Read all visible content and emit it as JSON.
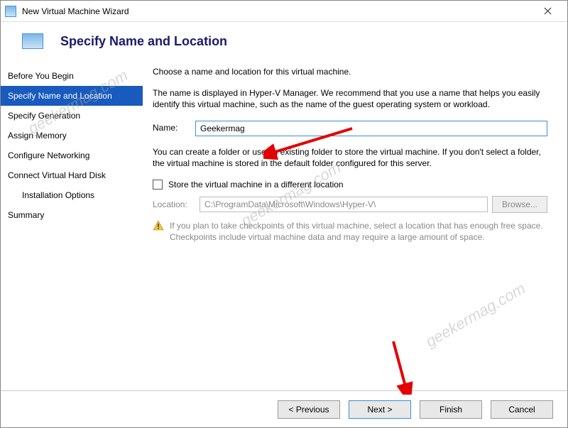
{
  "window": {
    "title": "New Virtual Machine Wizard"
  },
  "header": {
    "title": "Specify Name and Location"
  },
  "sidebar": {
    "items": [
      {
        "label": "Before You Begin"
      },
      {
        "label": "Specify Name and Location"
      },
      {
        "label": "Specify Generation"
      },
      {
        "label": "Assign Memory"
      },
      {
        "label": "Configure Networking"
      },
      {
        "label": "Connect Virtual Hard Disk"
      },
      {
        "label": "Installation Options"
      },
      {
        "label": "Summary"
      }
    ]
  },
  "content": {
    "intro": "Choose a name and location for this virtual machine.",
    "desc": "The name is displayed in Hyper-V Manager. We recommend that you use a name that helps you easily identify this virtual machine, such as the name of the guest operating system or workload.",
    "name_label": "Name:",
    "name_value": "Geekermag",
    "folder_desc": "You can create a folder or use an existing folder to store the virtual machine. If you don't select a folder, the virtual machine is stored in the default folder configured for this server.",
    "store_chk_label": "Store the virtual machine in a different location",
    "location_label": "Location:",
    "location_value": "C:\\ProgramData\\Microsoft\\Windows\\Hyper-V\\",
    "browse_label": "Browse...",
    "warn_text": "If you plan to take checkpoints of this virtual machine, select a location that has enough free space. Checkpoints include virtual machine data and may require a large amount of space."
  },
  "footer": {
    "previous": "< Previous",
    "next": "Next >",
    "finish": "Finish",
    "cancel": "Cancel"
  },
  "watermark": "geekermag.com"
}
